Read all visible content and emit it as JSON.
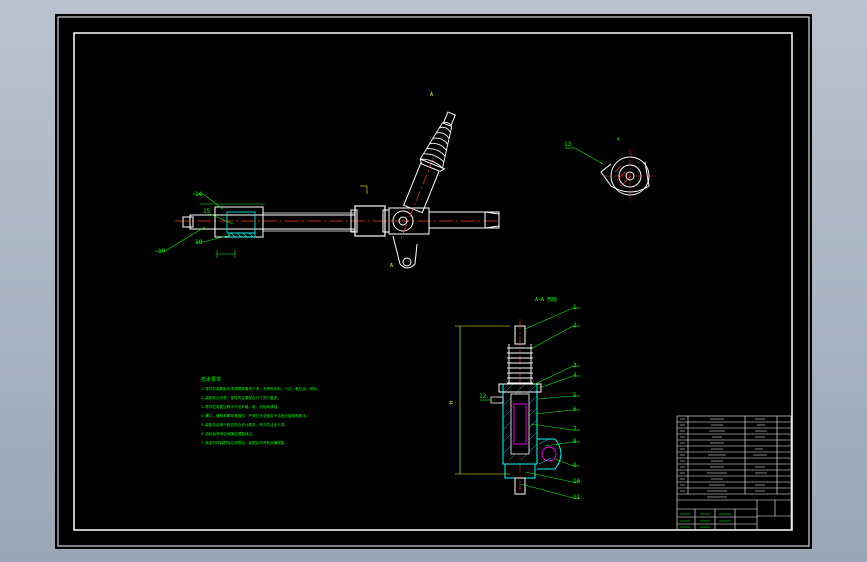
{
  "drawing": {
    "callouts_top": [
      "14",
      "18",
      "19",
      "15"
    ],
    "callout_detail": "13",
    "section_label": "A—A 剖面",
    "section_callouts": [
      "1",
      "2",
      "3",
      "4",
      "5",
      "6",
      "7",
      "8",
      "9",
      "10",
      "11",
      "12"
    ],
    "notes_title": "技术要求",
    "notes": [
      "1.零件在装配前必须清理和清洗干净，不得有毛刺、飞边、氧化皮、锈蚀。",
      "2.装配前应对零、部件的主要配合尺寸进行复查。",
      "3.零件在装配过程中不允许磕、碰、划伤和锈蚀。",
      "4.螺钉、螺栓和螺母紧固时，严禁打击或使用不合适的旋具和扳手。",
      "5.装配后齿条行程应符合设计要求，转向灵活无卡滞。",
      "6.齿轮齿条啮合间隙应调整适当。",
      "7.各密封件装配前应浸透油，装配后不得有渗漏现象。"
    ]
  },
  "colors": {
    "background": "#000000",
    "frame": "#ffffff",
    "geometry": "#ffffff",
    "centerline": "#ff3333",
    "annotation": "#00ff00",
    "hatch": "#00ffff",
    "hidden": "#ff00ff",
    "dimension": "#ffff00"
  }
}
